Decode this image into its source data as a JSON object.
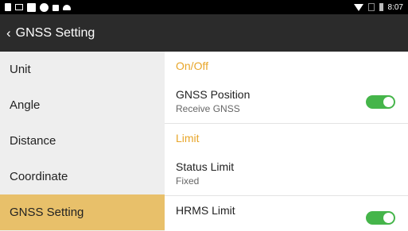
{
  "status_bar": {
    "time": "8:07",
    "icons": [
      "sim-icon",
      "gallery-icon",
      "document-icon",
      "circle-icon",
      "lock-icon",
      "android-icon",
      "wifi-icon",
      "no-sim-icon",
      "battery-icon"
    ]
  },
  "header": {
    "back_icon": "‹",
    "title": "GNSS Setting"
  },
  "sidebar": {
    "items": [
      {
        "label": "Unit"
      },
      {
        "label": "Angle"
      },
      {
        "label": "Distance"
      },
      {
        "label": "Coordinate"
      },
      {
        "label": "GNSS Setting",
        "active": true
      }
    ],
    "active_color": "#e8c06a"
  },
  "content": {
    "section1": "On/Off",
    "gnss_position": {
      "title": "GNSS Position",
      "subtitle": "Receive GNSS",
      "enabled": true
    },
    "section2": "Limit",
    "status_limit": {
      "title": "Status Limit",
      "subtitle": "Fixed"
    },
    "hrms_limit": {
      "title": "HRMS Limit",
      "enabled": true
    },
    "accent_color": "#e8a62a",
    "toggle_color": "#45b54a"
  }
}
